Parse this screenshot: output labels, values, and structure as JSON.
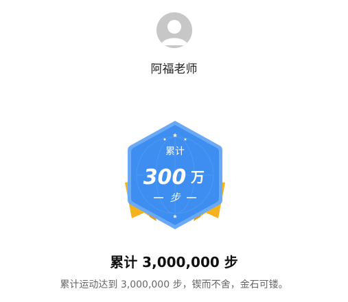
{
  "user": {
    "name": "阿福老师",
    "avatar_icon": "default-avatar-icon"
  },
  "badge": {
    "top_label": "累计",
    "amount": "300",
    "unit": "万",
    "bottom_label": "步",
    "colors": {
      "hexagon": "#3d8ef0",
      "hexagon_border": "#6aa9f5",
      "ribbon": "#f5b21f",
      "ribbon_dark": "#e39a10"
    }
  },
  "achievement": {
    "title": "累计 3,000,000 步",
    "description": "累计运动达到 3,000,000 步，锲而不舍，金石可镂。"
  }
}
